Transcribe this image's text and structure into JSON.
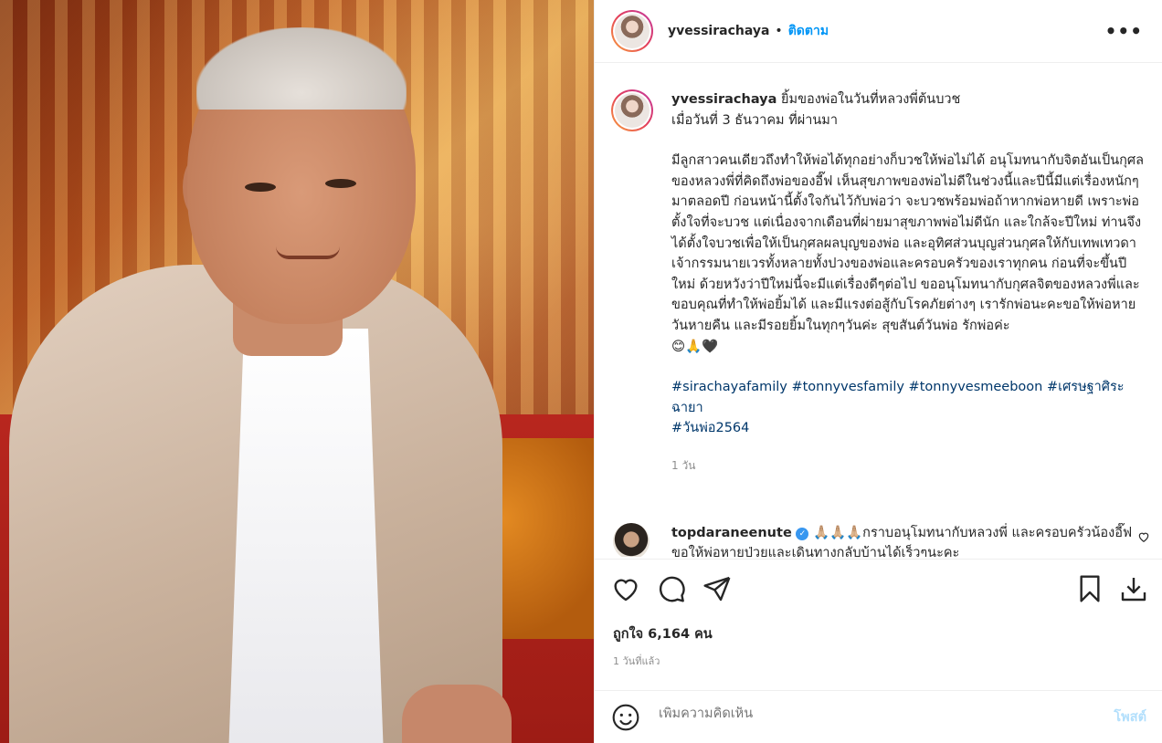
{
  "header": {
    "username": "yvessirachaya",
    "separator": "•",
    "follow_label": "ติดตาม",
    "more_label": "•••"
  },
  "caption": {
    "username": "yvessirachaya",
    "title_text": "ยิ้มของพ่อในวันที่หลวงพี่ต้นบวช",
    "subtitle_text": "เมื่อวันที่ 3 ธันวาคม ที่ผ่านมา",
    "body_text": "มีลูกสาวคนเดียวถึงทำให้พ่อได้ทุกอย่างก็บวชให้พ่อไม่ได้ อนุโมทนากับจิตอันเป็นกุศลของหลวงพี่ที่คิดถึงพ่อของอี๊ฟ เห็นสุขภาพของพ่อไม่ดีในช่วงนี้และปีนี้มีแต่เรื่องหนักๆมาตลอดปี ก่อนหน้านี้ตั้งใจกันไว้กับพ่อว่า จะบวชพร้อมพ่อถ้าหากพ่อหายดี เพราะพ่อตั้งใจที่จะบวช แต่เนื่องจากเดือนที่ผ่ายมาสุขภาพพ่อไม่ดีนัก และใกล้จะปีใหม่ ท่านจึงได้ตั้งใจบวชเพื่อให้เป็นกุศลผลบุญของพ่อ และอุทิศส่วนบุญส่วนกุศลให้กับเทพเทวดา เจ้ากรรมนายเวรทั้งหลายทั้งปวงของพ่อและครอบครัวของเราทุกคน ก่อนที่จะขึ้นปีใหม่ ด้วยหวังว่าปีใหม่นี้จะมีแต่เรื่องดีๆต่อไป ขออนุโมทนากับกุศลจิตของหลวงพี่และขอบคุณที่ทำให้พ่อยิ้มได้ และมีแรงต่อสู้กับโรคภัยต่างๆ เรารักพ่อนะคะขอให้พ่อหายวันหายคืน และมีรอยยิ้มในทุกๆวันค่ะ สุขสันต์วันพ่อ รักพ่อค่ะ",
    "emojis": "😊🙏🖤",
    "hashtags_line1": "#sirachayafamily #tonnyvesfamily #tonnyvesmeeboon #เศรษฐาศิระฉายา",
    "hashtags_line2": "#วันพ่อ2564",
    "time": "1 วัน"
  },
  "comment": {
    "username": "topdaraneenute",
    "verified_mark": "✓",
    "text": "🙏🏼🙏🏼🙏🏼กราบอนุโมทนากับหลวงพี่ และครอบครัวน้องอี๊ฟ ขอให้พ่อหายป่วยและเดินทางกลับบ้านได้เร็วๆนะคะ"
  },
  "actions": {
    "likes_text": "ถูกใจ 6,164 คน",
    "time_ago": "1 วันที่แล้ว"
  },
  "add_comment": {
    "placeholder": "เพิ่มความคิดเห็น",
    "post_label": "โพสต์"
  },
  "colors": {
    "accent": "#0095f6",
    "post_disabled": "#b2dffc",
    "hashtag": "#00376b",
    "muted": "#8e8e8e"
  },
  "icons": [
    "heart-icon",
    "comment-icon",
    "share-icon",
    "bookmark-icon",
    "download-icon",
    "emoji-icon",
    "more-icon",
    "verified-icon"
  ]
}
